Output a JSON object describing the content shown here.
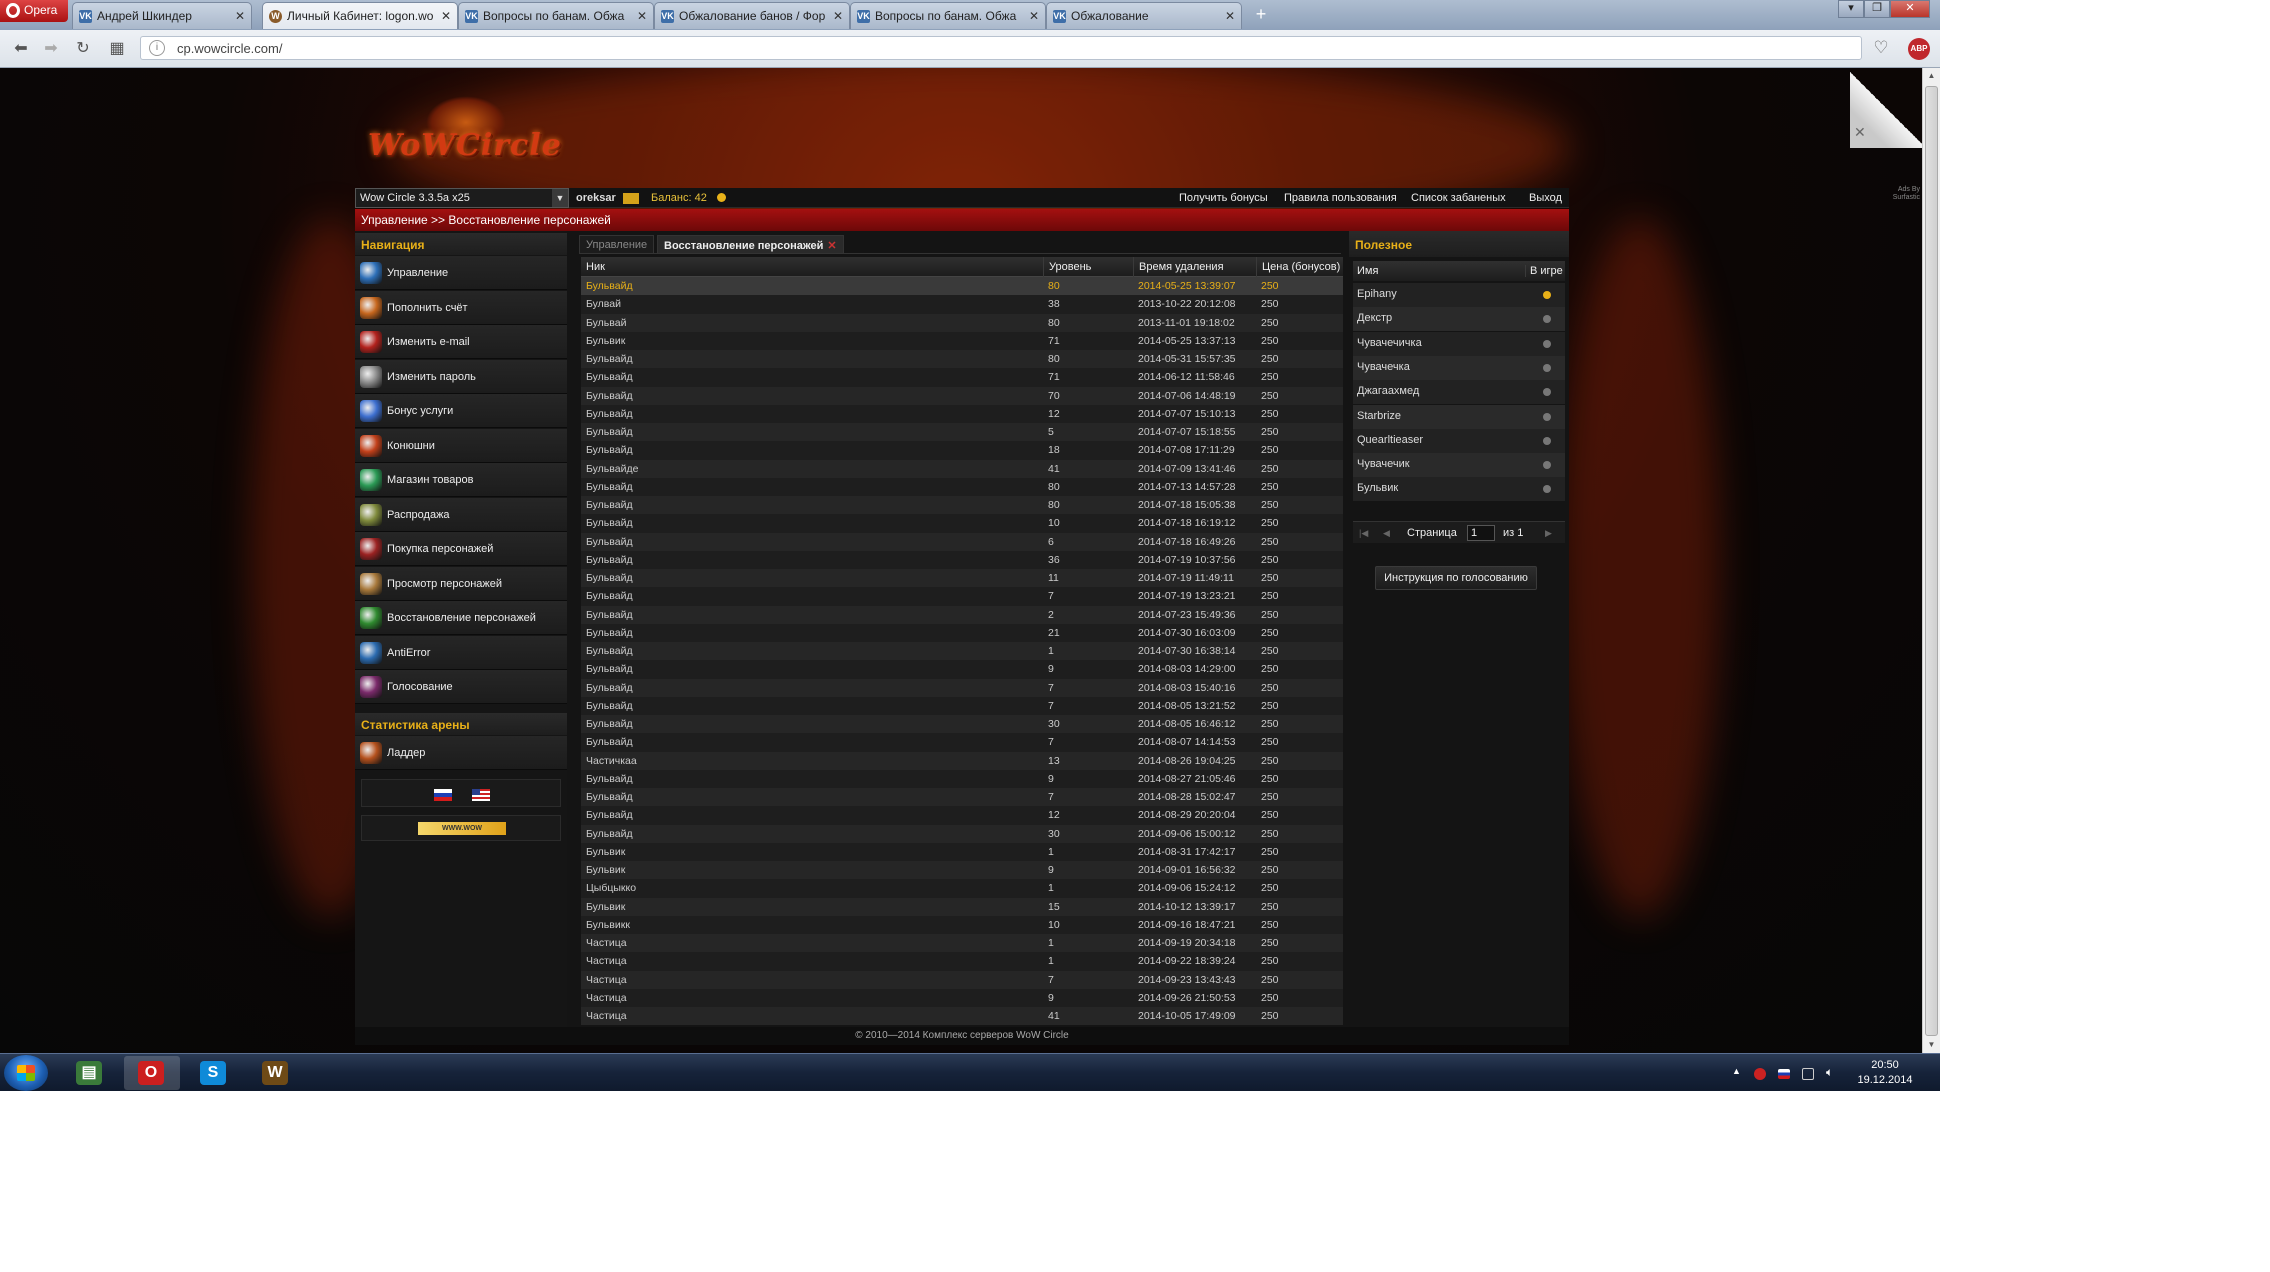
{
  "browser": {
    "menu_label": "Opera",
    "tabs": [
      {
        "title": "Андрей Шкиндер",
        "fav": "VK"
      },
      {
        "title": "Личный Кабинет: logon.wo",
        "fav": "W"
      },
      {
        "title": "Вопросы по банам. Обжа",
        "fav": "VK"
      },
      {
        "title": "Обжалование банов / Фор",
        "fav": "VK"
      },
      {
        "title": "Вопросы по банам. Обжа",
        "fav": "VK"
      },
      {
        "title": "Обжалование",
        "fav": "VK"
      }
    ],
    "close_glyph": "✕",
    "new_tab_glyph": "+",
    "url": "cp.wowcircle.com/",
    "abp_label": "ABP"
  },
  "site": {
    "logo_text": "WoWCircle",
    "realm_select": "Wow Circle 3.3.5a x25",
    "username": "oreksar",
    "balance_label": "Баланс:",
    "balance_value": "42",
    "top_links": [
      "Получить бонусы",
      "Правила пользования",
      "Список забаненых",
      "Выход"
    ],
    "breadcrumb": "Управление >> Восстановление персонажей",
    "ads_label": "Ads By Surfastic",
    "footer": "© 2010—2014 Комплекс серверов WoW Circle"
  },
  "sidebar": {
    "nav_title": "Навигация",
    "items": [
      {
        "label": "Управление",
        "icon": "manage-icon",
        "color": "#2d6fb8"
      },
      {
        "label": "Пополнить счёт",
        "icon": "deposit-icon",
        "color": "#c6661d"
      },
      {
        "label": "Изменить e-mail",
        "icon": "email-icon",
        "color": "#b3221d"
      },
      {
        "label": "Изменить пароль",
        "icon": "password-icon",
        "color": "#8a8a8a"
      },
      {
        "label": "Бонус услуги",
        "icon": "bonus-icon",
        "color": "#3d6fd0"
      },
      {
        "label": "Конюшни",
        "icon": "stable-icon",
        "color": "#c2401a"
      },
      {
        "label": "Магазин товаров",
        "icon": "shop-icon",
        "color": "#2a9a55"
      },
      {
        "label": "Распродажа",
        "icon": "sale-icon",
        "color": "#7f8a3c"
      },
      {
        "label": "Покупка персонажей",
        "icon": "buy-character-icon",
        "color": "#9b2222"
      },
      {
        "label": "Просмотр персонажей",
        "icon": "view-character-icon",
        "color": "#a8793b"
      },
      {
        "label": "Восстановление персонажей",
        "icon": "restore-character-icon",
        "color": "#2f8a2f"
      },
      {
        "label": "AntiError",
        "icon": "antierror-icon",
        "color": "#2b6bb0"
      },
      {
        "label": "Голосование",
        "icon": "vote-icon",
        "color": "#7a2a6a"
      }
    ],
    "arena_title": "Статистика арены",
    "arena_items": [
      {
        "label": "Ладдер",
        "icon": "ladder-icon",
        "color": "#b5511d"
      }
    ],
    "banner_text": "WWW.WOW"
  },
  "main": {
    "tabs": [
      {
        "label": "Управление",
        "active": false
      },
      {
        "label": "Восстановление персонажей",
        "active": true
      }
    ],
    "columns": [
      "Ник",
      "Уровень",
      "Время удаления",
      "Цена (бонусов)"
    ],
    "rows": [
      [
        "Бульвайд",
        "80",
        "2014-05-25 13:39:07",
        "250"
      ],
      [
        "Булвай",
        "38",
        "2013-10-22 20:12:08",
        "250"
      ],
      [
        "Бульвай",
        "80",
        "2013-11-01 19:18:02",
        "250"
      ],
      [
        "Бульвик",
        "71",
        "2014-05-25 13:37:13",
        "250"
      ],
      [
        "Бульвайд",
        "80",
        "2014-05-31 15:57:35",
        "250"
      ],
      [
        "Бульвайд",
        "71",
        "2014-06-12 11:58:46",
        "250"
      ],
      [
        "Бульвайд",
        "70",
        "2014-07-06 14:48:19",
        "250"
      ],
      [
        "Бульвайд",
        "12",
        "2014-07-07 15:10:13",
        "250"
      ],
      [
        "Бульвайд",
        "5",
        "2014-07-07 15:18:55",
        "250"
      ],
      [
        "Бульвайд",
        "18",
        "2014-07-08 17:11:29",
        "250"
      ],
      [
        "Бульвайде",
        "41",
        "2014-07-09 13:41:46",
        "250"
      ],
      [
        "Бульвайд",
        "80",
        "2014-07-13 14:57:28",
        "250"
      ],
      [
        "Бульвайд",
        "80",
        "2014-07-18 15:05:38",
        "250"
      ],
      [
        "Бульвайд",
        "10",
        "2014-07-18 16:19:12",
        "250"
      ],
      [
        "Бульвайд",
        "6",
        "2014-07-18 16:49:26",
        "250"
      ],
      [
        "Бульвайд",
        "36",
        "2014-07-19 10:37:56",
        "250"
      ],
      [
        "Бульвайд",
        "11",
        "2014-07-19 11:49:11",
        "250"
      ],
      [
        "Бульвайд",
        "7",
        "2014-07-19 13:23:21",
        "250"
      ],
      [
        "Бульвайд",
        "2",
        "2014-07-23 15:49:36",
        "250"
      ],
      [
        "Бульвайд",
        "21",
        "2014-07-30 16:03:09",
        "250"
      ],
      [
        "Бульвайд",
        "1",
        "2014-07-30 16:38:14",
        "250"
      ],
      [
        "Бульвайд",
        "9",
        "2014-08-03 14:29:00",
        "250"
      ],
      [
        "Бульвайд",
        "7",
        "2014-08-03 15:40:16",
        "250"
      ],
      [
        "Бульвайд",
        "7",
        "2014-08-05 13:21:52",
        "250"
      ],
      [
        "Бульвайд",
        "30",
        "2014-08-05 16:46:12",
        "250"
      ],
      [
        "Бульвайд",
        "7",
        "2014-08-07 14:14:53",
        "250"
      ],
      [
        "Частичкаа",
        "13",
        "2014-08-26 19:04:25",
        "250"
      ],
      [
        "Бульвайд",
        "9",
        "2014-08-27 21:05:46",
        "250"
      ],
      [
        "Бульвайд",
        "7",
        "2014-08-28 15:02:47",
        "250"
      ],
      [
        "Бульвайд",
        "12",
        "2014-08-29 20:20:04",
        "250"
      ],
      [
        "Бульвайд",
        "30",
        "2014-09-06 15:00:12",
        "250"
      ],
      [
        "Бульвик",
        "1",
        "2014-08-31 17:42:17",
        "250"
      ],
      [
        "Бульвик",
        "9",
        "2014-09-01 16:56:32",
        "250"
      ],
      [
        "Цыбцыкко",
        "1",
        "2014-09-06 15:24:12",
        "250"
      ],
      [
        "Бульвик",
        "15",
        "2014-10-12 13:39:17",
        "250"
      ],
      [
        "Бульвикк",
        "10",
        "2014-09-16 18:47:21",
        "250"
      ],
      [
        "Частица",
        "1",
        "2014-09-19 20:34:18",
        "250"
      ],
      [
        "Частица",
        "1",
        "2014-09-22 18:39:24",
        "250"
      ],
      [
        "Частица",
        "7",
        "2014-09-23 13:43:43",
        "250"
      ],
      [
        "Частица",
        "9",
        "2014-09-26 21:50:53",
        "250"
      ],
      [
        "Частица",
        "41",
        "2014-10-05 17:49:09",
        "250"
      ]
    ]
  },
  "right": {
    "title": "Полезное",
    "col_name": "Имя",
    "col_ingame": "В игре",
    "characters": [
      {
        "name": "Epihany",
        "online": true
      },
      {
        "name": "Декстр",
        "online": false
      },
      {
        "name": "Чувачечичка",
        "online": false
      },
      {
        "name": "Чувачечка",
        "online": false
      },
      {
        "name": "Джагаахмед",
        "online": false
      },
      {
        "name": "Starbrize",
        "online": false
      },
      {
        "name": "Quearltieaser",
        "online": false
      },
      {
        "name": "Чувачечик",
        "online": false
      },
      {
        "name": "Бульвик",
        "online": false
      }
    ],
    "pager_label": "Страница",
    "pager_value": "1",
    "pager_of": "из 1",
    "vote_button": "Инструкция по голосованию"
  },
  "taskbar": {
    "apps": [
      {
        "icon": "explorer-icon",
        "glyph": "▤",
        "color": "#3a7a3a"
      },
      {
        "icon": "opera-icon",
        "glyph": "O",
        "color": "#cc1f1f"
      },
      {
        "icon": "skype-icon",
        "glyph": "S",
        "color": "#0f8ad8"
      },
      {
        "icon": "wow-icon",
        "glyph": "W",
        "color": "#6e4a16"
      }
    ],
    "time": "20:50",
    "date": "19.12.2014"
  }
}
